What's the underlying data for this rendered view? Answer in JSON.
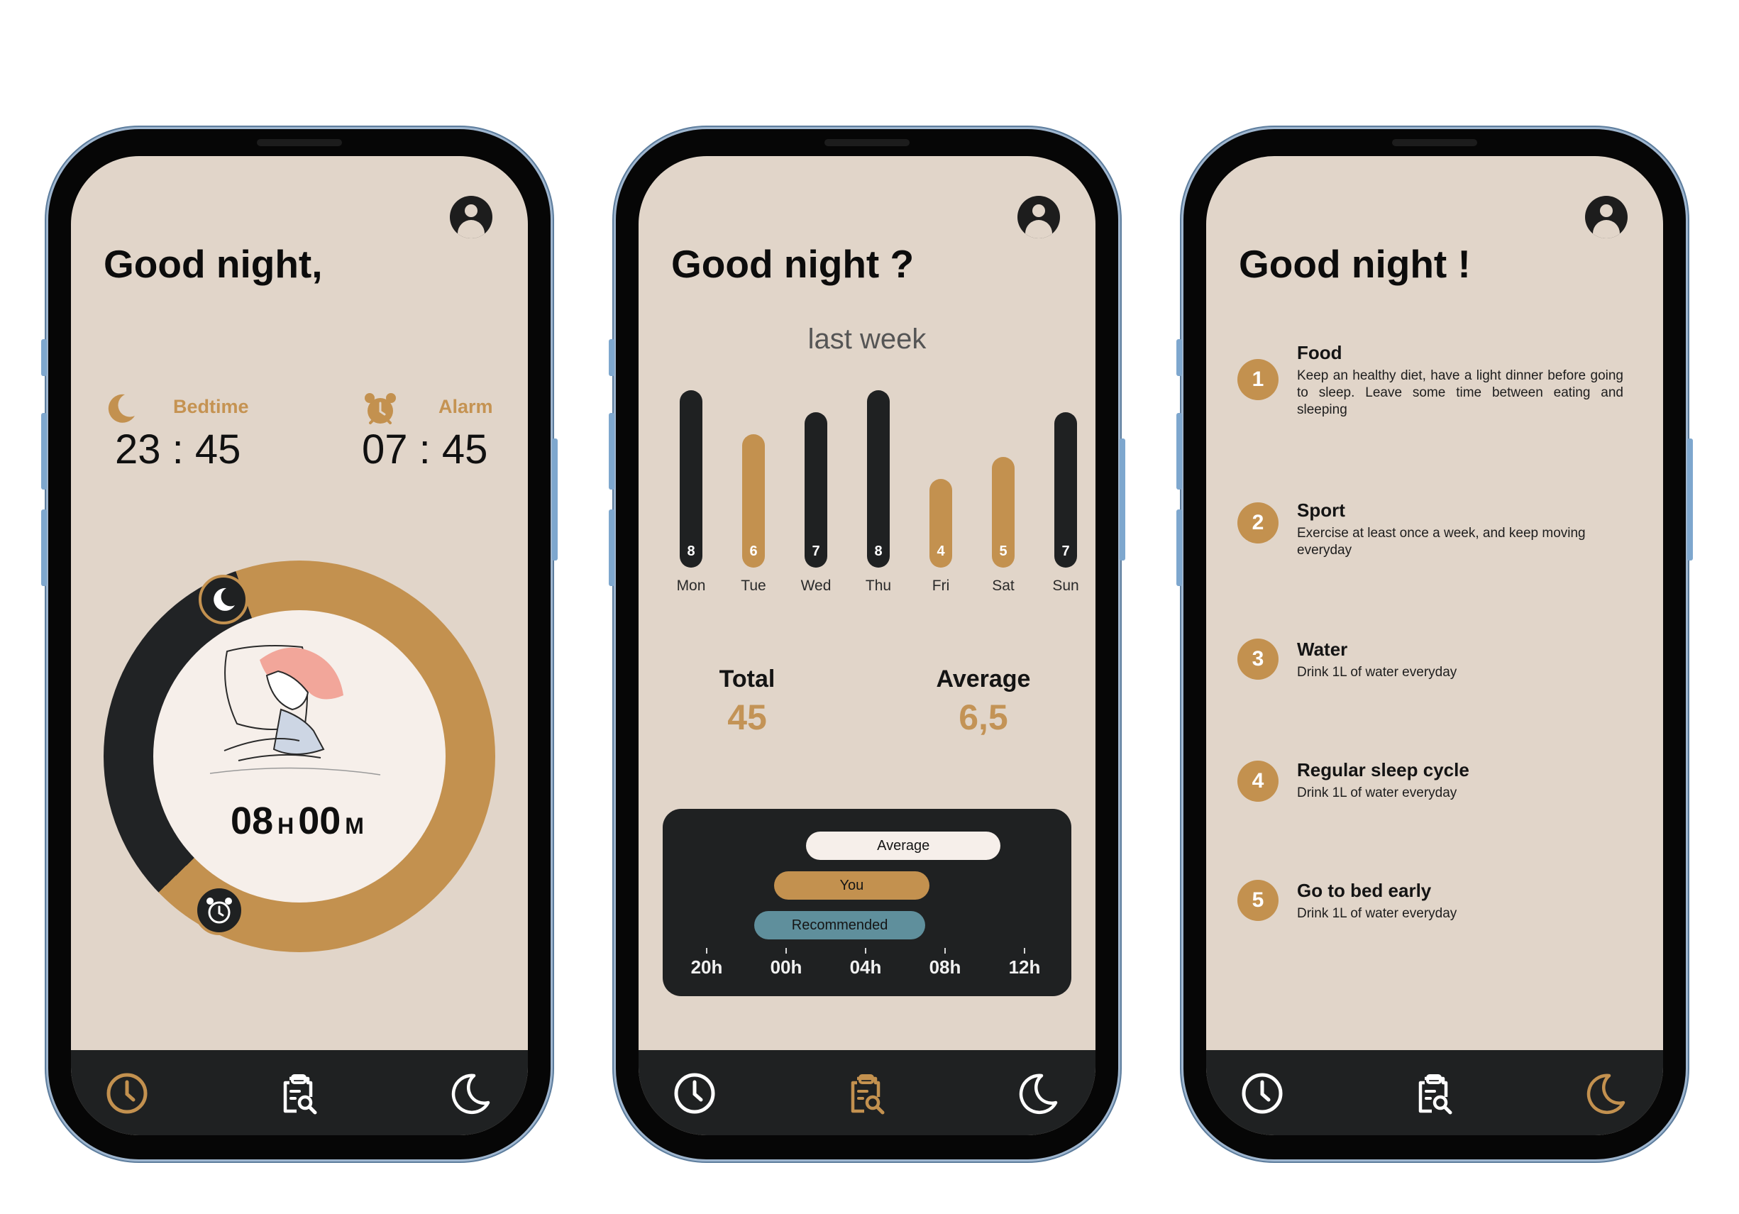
{
  "colors": {
    "accent": "#c3914f",
    "dark": "#1f2122",
    "background": "#e1d5c9",
    "recommended": "#5f8f9c",
    "light": "#f6efea"
  },
  "screen1": {
    "greeting": "Good night,",
    "bedtime_label": "Bedtime",
    "bedtime_value": "23 : 45",
    "alarm_label": "Alarm",
    "alarm_value": "07 : 45",
    "duration_hours": "08",
    "duration_hours_unit": "H",
    "duration_minutes": "00",
    "duration_minutes_unit": "M"
  },
  "screen2": {
    "greeting": "Good night ?",
    "period_label": "last week",
    "chart_data": {
      "type": "bar",
      "categories": [
        "Mon",
        "Tue",
        "Wed",
        "Thu",
        "Fri",
        "Sat",
        "Sun"
      ],
      "values": [
        8,
        6,
        7,
        8,
        4,
        5,
        7
      ],
      "value_labels": [
        "8",
        "6",
        "7",
        "8",
        "4",
        "5",
        "7"
      ],
      "highlighted": [
        false,
        true,
        false,
        false,
        true,
        true,
        false
      ],
      "ylim": [
        0,
        8
      ]
    },
    "total_label": "Total",
    "total_value": "45",
    "average_label": "Average",
    "average_value": "6,5",
    "timeline": {
      "ticks": [
        "20h",
        "00h",
        "04h",
        "08h",
        "12h"
      ],
      "ranges": [
        {
          "label": "Average",
          "start": 2.5,
          "end": 7.4,
          "color": "#f6efea"
        },
        {
          "label": "You",
          "start": 1.7,
          "end": 5.6,
          "color": "#c3914f"
        },
        {
          "label": "Recommended",
          "start": 1.2,
          "end": 5.5,
          "color": "#5f8f9c"
        }
      ]
    }
  },
  "screen3": {
    "greeting": "Good night !",
    "tips": [
      {
        "num": "1",
        "title": "Food",
        "text": "Keep an healthy diet, have a light dinner before going to sleep. Leave some time between eating and sleeping"
      },
      {
        "num": "2",
        "title": "Sport",
        "text": "Exercise at least once a week, and keep moving everyday"
      },
      {
        "num": "3",
        "title": "Water",
        "text": "Drink 1L of water everyday"
      },
      {
        "num": "4",
        "title": "Regular sleep cycle",
        "text": "Drink 1L of water everyday"
      },
      {
        "num": "5",
        "title": "Go to bed early",
        "text": "Drink 1L of water everyday"
      }
    ]
  },
  "nav": [
    {
      "name": "clock",
      "icon": "clock-icon"
    },
    {
      "name": "report",
      "icon": "clipboard-search-icon"
    },
    {
      "name": "sleep",
      "icon": "moon-icon"
    }
  ],
  "nav_active": [
    0,
    1,
    2
  ]
}
